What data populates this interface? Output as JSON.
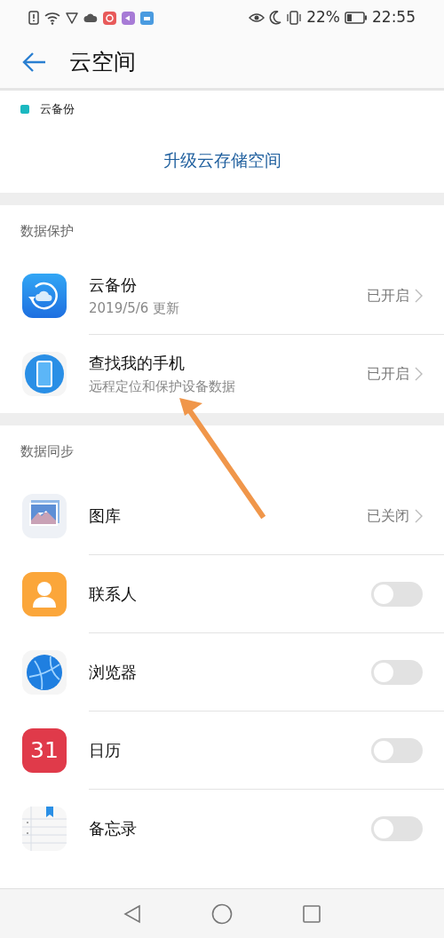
{
  "status_bar": {
    "battery_text": "22%",
    "time": "22:55"
  },
  "header": {
    "title": "云空间"
  },
  "storage_legend": {
    "label": "云备份",
    "color": "#1bb8c0"
  },
  "upgrade_button": "升级云存储空间",
  "sections": [
    {
      "title": "数据保护",
      "items": [
        {
          "kind": "status",
          "title": "云备份",
          "subtitle": "2019/5/6 更新",
          "status": "已开启"
        },
        {
          "kind": "status",
          "title": "查找我的手机",
          "subtitle": "远程定位和保护设备数据",
          "status": "已开启"
        }
      ]
    },
    {
      "title": "数据同步",
      "items": [
        {
          "kind": "status",
          "title": "图库",
          "status": "已关闭"
        },
        {
          "kind": "toggle",
          "title": "联系人",
          "on": false
        },
        {
          "kind": "toggle",
          "title": "浏览器",
          "on": false
        },
        {
          "kind": "toggle",
          "title": "日历",
          "on": false,
          "icon_text": "31"
        },
        {
          "kind": "toggle",
          "title": "备忘录",
          "on": false
        }
      ]
    }
  ]
}
